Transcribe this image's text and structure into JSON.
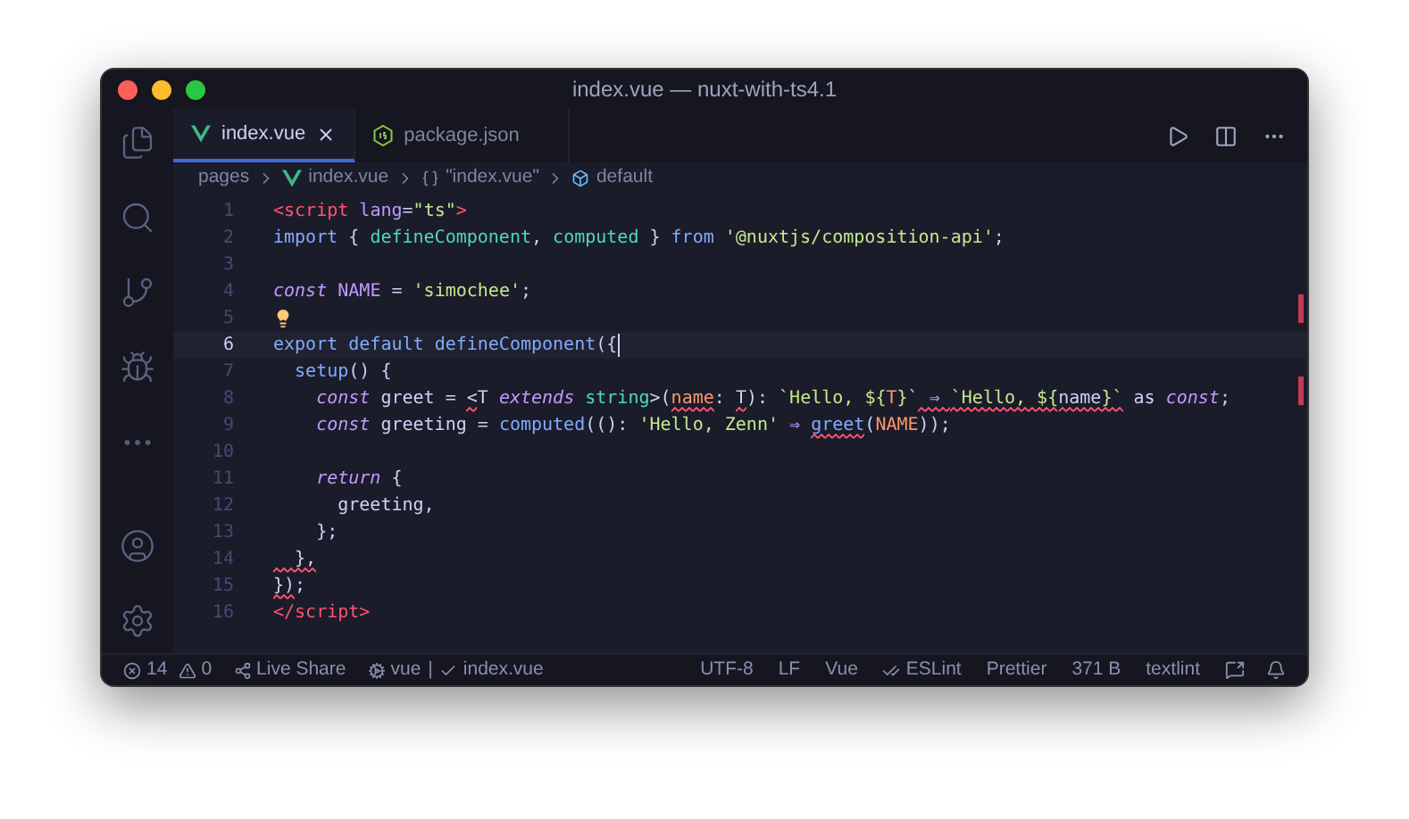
{
  "window": {
    "title": "index.vue — nuxt-with-ts4.1"
  },
  "tabs": [
    {
      "label": "index.vue",
      "kind": "vue",
      "selected": true
    },
    {
      "label": "package.json",
      "kind": "json",
      "selected": false
    }
  ],
  "breadcrumb": [
    {
      "label": "pages",
      "kind": "folder"
    },
    {
      "label": "index.vue",
      "kind": "vue"
    },
    {
      "label": "\"index.vue\"",
      "kind": "braces"
    },
    {
      "label": "default",
      "kind": "symbol"
    }
  ],
  "code": [
    {
      "number": "1",
      "current": false,
      "lightbulb": false,
      "tokens": [
        {
          "text": "<script",
          "kind": "tag"
        },
        {
          "text": " lang",
          "kind": "attr"
        },
        {
          "text": "=",
          "kind": "plain"
        },
        {
          "text": "\"ts\"",
          "kind": "string"
        },
        {
          "text": ">",
          "kind": "tag"
        }
      ]
    },
    {
      "number": "2",
      "current": false,
      "lightbulb": false,
      "tokens": [
        {
          "text": "import",
          "kind": "keyword"
        },
        {
          "text": " { ",
          "kind": "plain"
        },
        {
          "text": "defineComponent",
          "kind": "func"
        },
        {
          "text": ", ",
          "kind": "plain"
        },
        {
          "text": "computed",
          "kind": "func"
        },
        {
          "text": " } ",
          "kind": "plain"
        },
        {
          "text": "from",
          "kind": "keyword"
        },
        {
          "text": " '@nuxtjs/composition-api'",
          "kind": "string"
        },
        {
          "text": ";",
          "kind": "plain"
        }
      ]
    },
    {
      "number": "3",
      "current": false,
      "lightbulb": false
    },
    {
      "number": "4",
      "current": false,
      "lightbulb": false,
      "tokens": [
        {
          "text": "const",
          "kind": "storage"
        },
        {
          "text": " NAME",
          "kind": "constant"
        },
        {
          "text": " = ",
          "kind": "plain"
        },
        {
          "text": "'simochee'",
          "kind": "string"
        },
        {
          "text": ";",
          "kind": "plain"
        }
      ]
    },
    {
      "number": "5",
      "current": false,
      "lightbulb": true
    },
    {
      "number": "6",
      "current": true,
      "lightbulb": false,
      "tokens": [
        {
          "text": "export default ",
          "kind": "keyword"
        },
        {
          "text": "defineComponent",
          "kind": "call"
        },
        {
          "text": "({",
          "kind": "plain"
        }
      ]
    },
    {
      "number": "7",
      "current": false,
      "lightbulb": false,
      "tokens": [
        {
          "text": "  setup",
          "kind": "call"
        },
        {
          "text": "() {",
          "kind": "plain"
        }
      ]
    },
    {
      "number": "8",
      "current": false,
      "lightbulb": false,
      "tokens": [
        {
          "text": "    const",
          "kind": "storage"
        },
        {
          "text": " greet = ",
          "kind": "plain"
        },
        {
          "text": "<",
          "kind": "plain",
          "error": true
        },
        {
          "text": "T",
          "kind": "plain",
          "error": false
        },
        {
          "text": " extends ",
          "kind": "storage"
        },
        {
          "text": "string",
          "kind": "func"
        },
        {
          "text": ">(",
          "kind": "plain"
        },
        {
          "text": "name",
          "kind": "param",
          "error": true
        },
        {
          "text": ": ",
          "kind": "plain"
        },
        {
          "text": "T",
          "kind": "plain",
          "error": true
        },
        {
          "text": "): ",
          "kind": "plain"
        },
        {
          "text": "`Hello, ${",
          "kind": "string"
        },
        {
          "text": "T",
          "kind": "param"
        },
        {
          "text": "}`",
          "kind": "string"
        },
        {
          "text": " ⇒ ",
          "kind": "storage",
          "error": true
        },
        {
          "text": "`Hello, ${",
          "kind": "string",
          "error": true
        },
        {
          "text": "name",
          "kind": "plain",
          "error": true
        },
        {
          "text": "}`",
          "kind": "string",
          "error": true
        },
        {
          "text": " as ",
          "kind": "plain"
        },
        {
          "text": "const",
          "kind": "storage"
        },
        {
          "text": ";",
          "kind": "plain"
        }
      ]
    },
    {
      "number": "9",
      "current": false,
      "lightbulb": false,
      "tokens": [
        {
          "text": "    const",
          "kind": "storage"
        },
        {
          "text": " greeting = ",
          "kind": "plain"
        },
        {
          "text": "computed",
          "kind": "call"
        },
        {
          "text": "((): ",
          "kind": "plain"
        },
        {
          "text": "'Hello, Zenn'",
          "kind": "string"
        },
        {
          "text": " ⇒ ",
          "kind": "storage"
        },
        {
          "text": "greet",
          "kind": "call",
          "error": true
        },
        {
          "text": "(",
          "kind": "plain"
        },
        {
          "text": "NAME",
          "kind": "param"
        },
        {
          "text": "));",
          "kind": "plain"
        }
      ]
    },
    {
      "number": "10",
      "current": false,
      "lightbulb": false
    },
    {
      "number": "11",
      "current": false,
      "lightbulb": false,
      "tokens": [
        {
          "text": "    return",
          "kind": "storage"
        },
        {
          "text": " {",
          "kind": "plain"
        }
      ]
    },
    {
      "number": "12",
      "current": false,
      "lightbulb": false,
      "tokens": [
        {
          "text": "      greeting,",
          "kind": "plain"
        }
      ]
    },
    {
      "number": "13",
      "current": false,
      "lightbulb": false,
      "tokens": [
        {
          "text": "    };",
          "kind": "plain"
        }
      ]
    },
    {
      "number": "14",
      "current": false,
      "lightbulb": false,
      "tokens": [
        {
          "text": "  },",
          "kind": "plain",
          "error": true
        }
      ]
    },
    {
      "number": "15",
      "current": false,
      "lightbulb": false,
      "tokens": [
        {
          "text": "})",
          "kind": "plain",
          "error": true
        },
        {
          "text": ";",
          "kind": "plain"
        }
      ]
    },
    {
      "number": "16",
      "current": false,
      "lightbulb": false,
      "tokens": [
        {
          "text": "</script",
          "kind": "tag"
        },
        {
          "text": ">",
          "kind": "tag"
        }
      ]
    }
  ],
  "status_bar": {
    "errors": "14",
    "warnings": "0",
    "left": [
      {
        "label": "Live Share",
        "kind": "share"
      },
      {
        "label": "vue",
        "kind": "gear"
      },
      {
        "label": "|",
        "kind": "text"
      },
      {
        "label": "index.vue",
        "kind": "check"
      }
    ],
    "right": [
      {
        "label": "UTF-8",
        "kind": "text"
      },
      {
        "label": "LF",
        "kind": "text"
      },
      {
        "label": "Vue",
        "kind": "text"
      },
      {
        "label": "ESLint",
        "kind": "checks"
      },
      {
        "label": "Prettier",
        "kind": "text"
      },
      {
        "label": "371 B",
        "kind": "text"
      },
      {
        "label": "textlint",
        "kind": "text"
      }
    ]
  }
}
